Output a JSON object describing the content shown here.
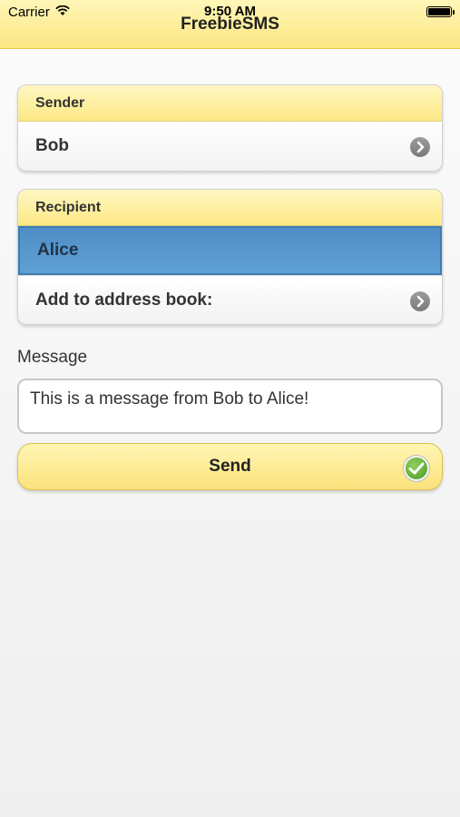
{
  "status_bar": {
    "carrier": "Carrier",
    "time": "9:50 AM"
  },
  "app": {
    "title": "FreebieSMS"
  },
  "sender": {
    "header": "Sender",
    "name": "Bob"
  },
  "recipient": {
    "header": "Recipient",
    "name": "Alice",
    "add_to_address_book": "Add to address book:"
  },
  "message": {
    "label": "Message",
    "value": "This is a message from Bob to Alice!"
  },
  "send": {
    "label": "Send"
  },
  "icons": {
    "wifi": "wifi-icon",
    "battery": "battery-icon",
    "disclosure": "chevron-right-circle-icon",
    "send": "checkmark-circle-icon"
  },
  "colors": {
    "header_yellow": "#fde783",
    "selected_blue": "#5ea0d4",
    "check_green": "#4a9a24"
  }
}
